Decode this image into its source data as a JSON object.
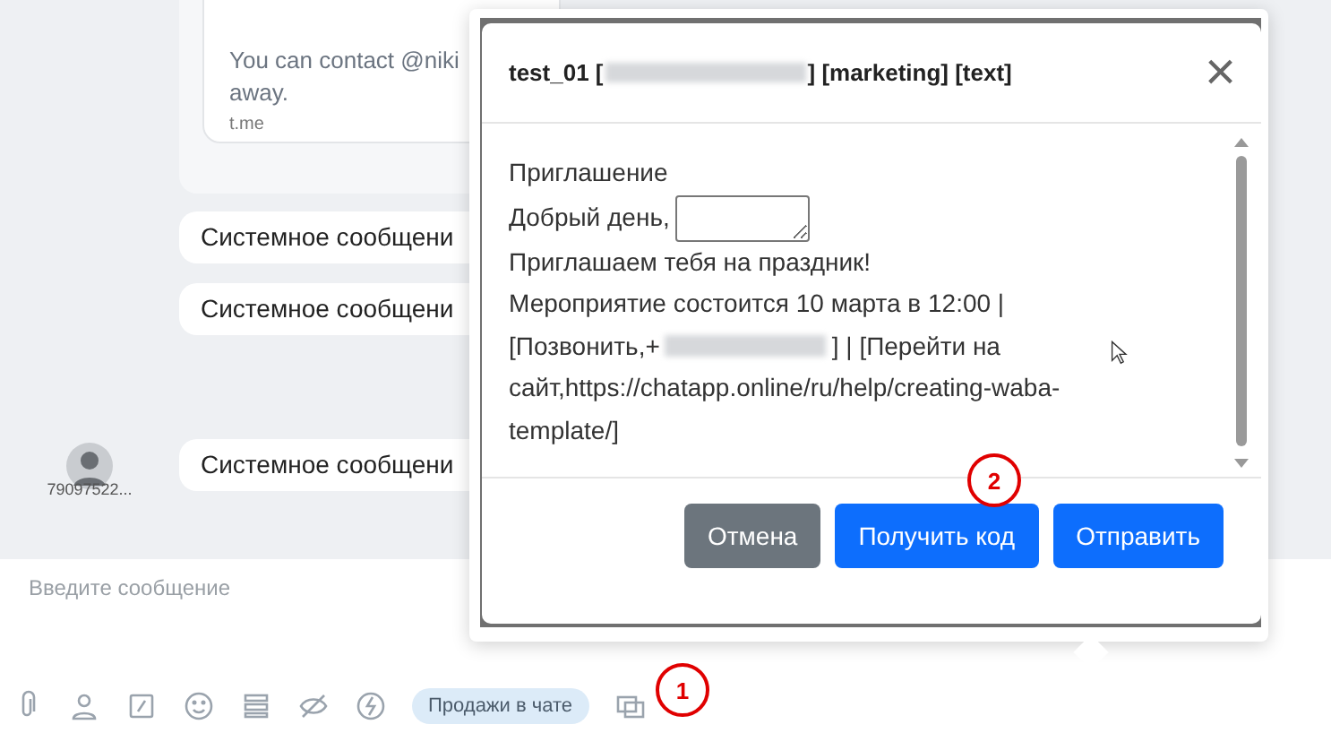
{
  "chat": {
    "link_card": {
      "text": "You can contact @niki",
      "text_cont": "away.",
      "domain": "t.me"
    },
    "messages": [
      {
        "text": "Системное сообщени"
      },
      {
        "text": "Системное сообщени"
      },
      {
        "text": "Системное сообщени",
        "sender": "79097522..."
      }
    ]
  },
  "composer": {
    "placeholder": "Введите сообщение",
    "chip": "Продажи в чате"
  },
  "modal": {
    "title": "test_01 [",
    "title_rest": "] [marketing] [text]",
    "close": "×",
    "lines": [
      "Приглашение",
      "Добрый день,",
      "Приглашаем тебя на праздник!",
      "Мероприятие состоится 10 марта в 12:00 |"
    ],
    "call_prefix": "[Позвонить,+",
    "call_rest": "] | [Перейти на",
    "wrap_lines": [
      "сайт,https://chatapp.online/ru/help/creating-waba-",
      "template/]"
    ],
    "buttons": [
      {
        "label": "Отмена",
        "kind": "secondary"
      },
      {
        "label": "Получить код",
        "kind": "primary"
      },
      {
        "label": "Отправить",
        "kind": "primary"
      }
    ]
  },
  "annotations": [
    {
      "label": "1"
    },
    {
      "label": "2"
    }
  ]
}
